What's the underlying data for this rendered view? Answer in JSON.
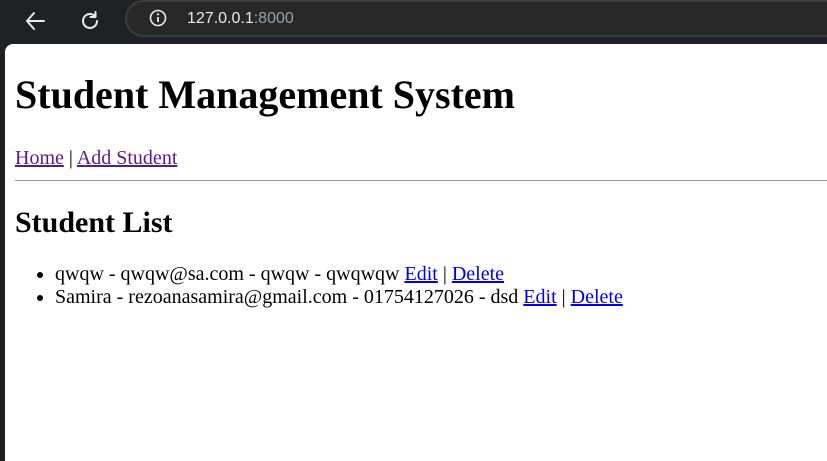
{
  "browser": {
    "url_host": "127.0.0.1",
    "url_port": ":8000"
  },
  "page": {
    "title": "Student Management System",
    "nav": {
      "home": "Home",
      "separator": "|",
      "add_student": "Add Student"
    },
    "section_title": "Student List",
    "students": [
      {
        "text": "qwqw - qwqw@sa.com - qwqw - qwqwqw",
        "edit": "Edit",
        "separator": "|",
        "delete": "Delete"
      },
      {
        "text": "Samira - rezoanasamira@gmail.com - 01754127026 - dsd",
        "edit": "Edit",
        "separator": "|",
        "delete": "Delete"
      }
    ]
  }
}
